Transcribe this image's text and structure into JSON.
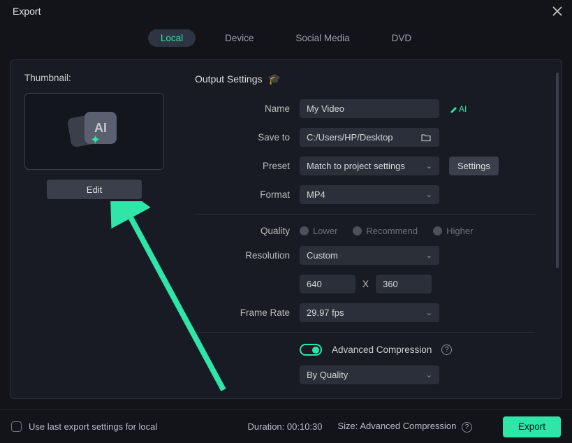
{
  "window": {
    "title": "Export"
  },
  "tabs": [
    "Local",
    "Device",
    "Social Media",
    "DVD"
  ],
  "activeTab": 0,
  "thumbnail": {
    "label": "Thumbnail:",
    "editLabel": "Edit",
    "iconText": "AI"
  },
  "outputSettings": {
    "header": "Output Settings",
    "nameLabel": "Name",
    "nameValue": "My Video",
    "aiBadge": "AI",
    "saveToLabel": "Save to",
    "saveToValue": "C:/Users/HP/Desktop",
    "presetLabel": "Preset",
    "presetValue": "Match to project settings",
    "settingsBtn": "Settings",
    "formatLabel": "Format",
    "formatValue": "MP4",
    "qualityLabel": "Quality",
    "qualityOptions": [
      "Lower",
      "Recommend",
      "Higher"
    ],
    "qualitySelected": 1,
    "resolutionLabel": "Resolution",
    "resolutionValue": "Custom",
    "widthValue": "640",
    "heightValue": "360",
    "xSep": "X",
    "frameRateLabel": "Frame Rate",
    "frameRateValue": "29.97 fps",
    "advCompLabel": "Advanced Compression",
    "advCompOn": true,
    "compModeValue": "By Quality"
  },
  "footer": {
    "useLast": "Use last export settings for local",
    "durationLabel": "Duration:",
    "durationValue": "00:10:30",
    "sizeLabel": "Size:",
    "sizeValue": "Advanced Compression",
    "exportBtn": "Export"
  }
}
